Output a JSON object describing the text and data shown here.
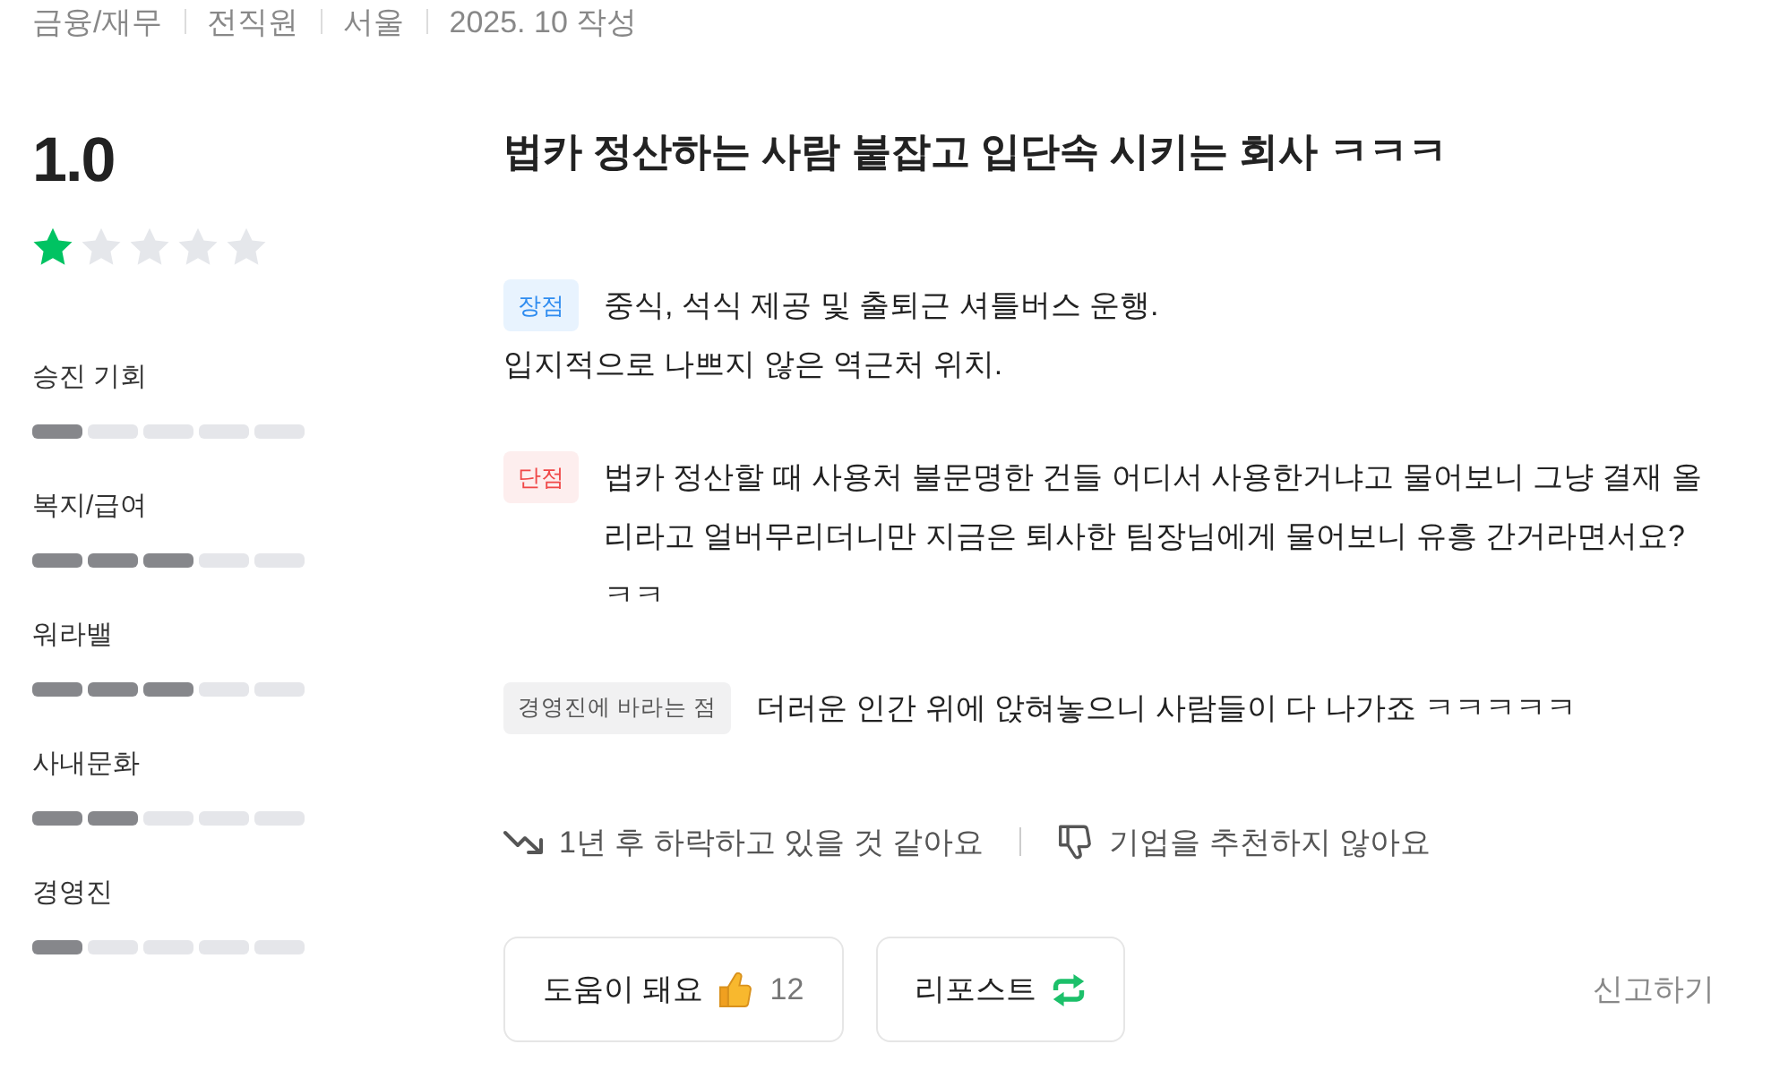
{
  "meta": [
    "금융/재무",
    "전직원",
    "서울",
    "2025. 10 작성"
  ],
  "rating": {
    "score": "1.0",
    "stars": 1
  },
  "categories": [
    {
      "label": "승진 기회",
      "level": 0.2
    },
    {
      "label": "복지/급여",
      "level": 0.6
    },
    {
      "label": "워라밸",
      "level": 0.6
    },
    {
      "label": "사내문화",
      "level": 0.4
    },
    {
      "label": "경영진",
      "level": 0.2
    }
  ],
  "review": {
    "title": "법카 정산하는 사람 붙잡고 입단속 시키는 회사 ㅋㅋㅋ",
    "sections": [
      {
        "kind": "pros",
        "tag": "장점",
        "text": "중식, 석식 제공 및 출퇴근 셔틀버스 운행.\n입지적으로 나쁘지 않은 역근처 위치."
      },
      {
        "kind": "cons",
        "tag": "단점",
        "text": "법카 정산할 때 사용처 불문명한 건들 어디서 사용한거냐고 물어보니 그냥 결재 올리라고 얼버무리더니만 지금은 퇴사한 팀장님에게 물어보니 유흥 간거라면서요? ㅋㅋ"
      },
      {
        "kind": "wish",
        "tag": "경영진에 바라는 점",
        "text": "더러운 인간 위에 앉혀놓으니 사람들이 다 나가죠 ㅋㅋㅋㅋㅋ"
      }
    ],
    "outlook": [
      {
        "kind": "trend_down",
        "text": "1년 후 하락하고 있을 것 같아요"
      },
      {
        "kind": "not_recommend",
        "text": "기업을 추천하지 않아요"
      }
    ]
  },
  "actions": {
    "helpful": {
      "label": "도움이 돼요",
      "count": "12"
    },
    "repost": {
      "label": "리포스트"
    },
    "report": "신고하기"
  }
}
